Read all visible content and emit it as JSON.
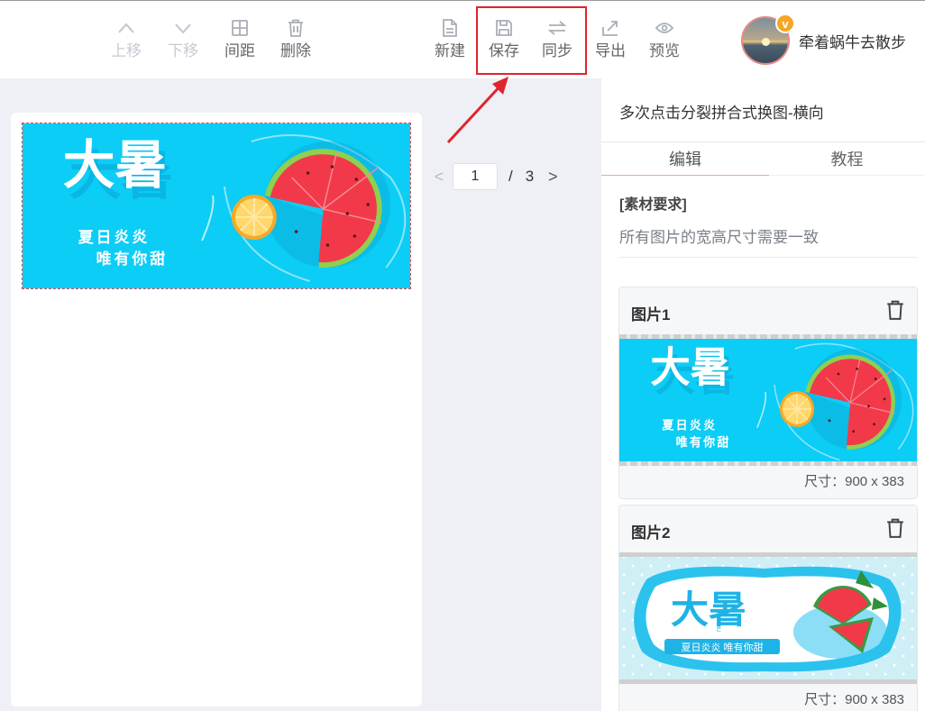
{
  "toolbar": {
    "move_up": "上移",
    "move_down": "下移",
    "spacing": "间距",
    "delete": "删除",
    "new": "新建",
    "save": "保存",
    "sync": "同步",
    "export": "导出",
    "preview": "预览"
  },
  "user": {
    "name": "牵着蜗牛去散步",
    "badge": "v"
  },
  "pager": {
    "current": "1",
    "separator": "/",
    "total": "3",
    "prev": "<",
    "next": ">"
  },
  "panel": {
    "title": "多次点击分裂拼合式换图-横向",
    "tabs": [
      "编辑",
      "教程"
    ],
    "requirement_title": "[素材要求]",
    "requirement_text": "所有图片的宽高尺寸需要一致"
  },
  "images": [
    {
      "name": "图片1",
      "size_text": "尺寸：900 x 383"
    },
    {
      "name": "图片2",
      "size_text": "尺寸：900 x 383"
    }
  ],
  "banner1": {
    "title": "大暑",
    "line1": "夏日炎炎",
    "line2": "唯有你甜"
  },
  "banner2": {
    "title": "大暑",
    "pinyin": "DA SHU",
    "subtitle": "夏日炎炎 唯有你甜"
  },
  "colors": {
    "accent_red": "#e0242c",
    "banner_blue": "#0ccdf5",
    "watermelon": "#f2394a"
  }
}
